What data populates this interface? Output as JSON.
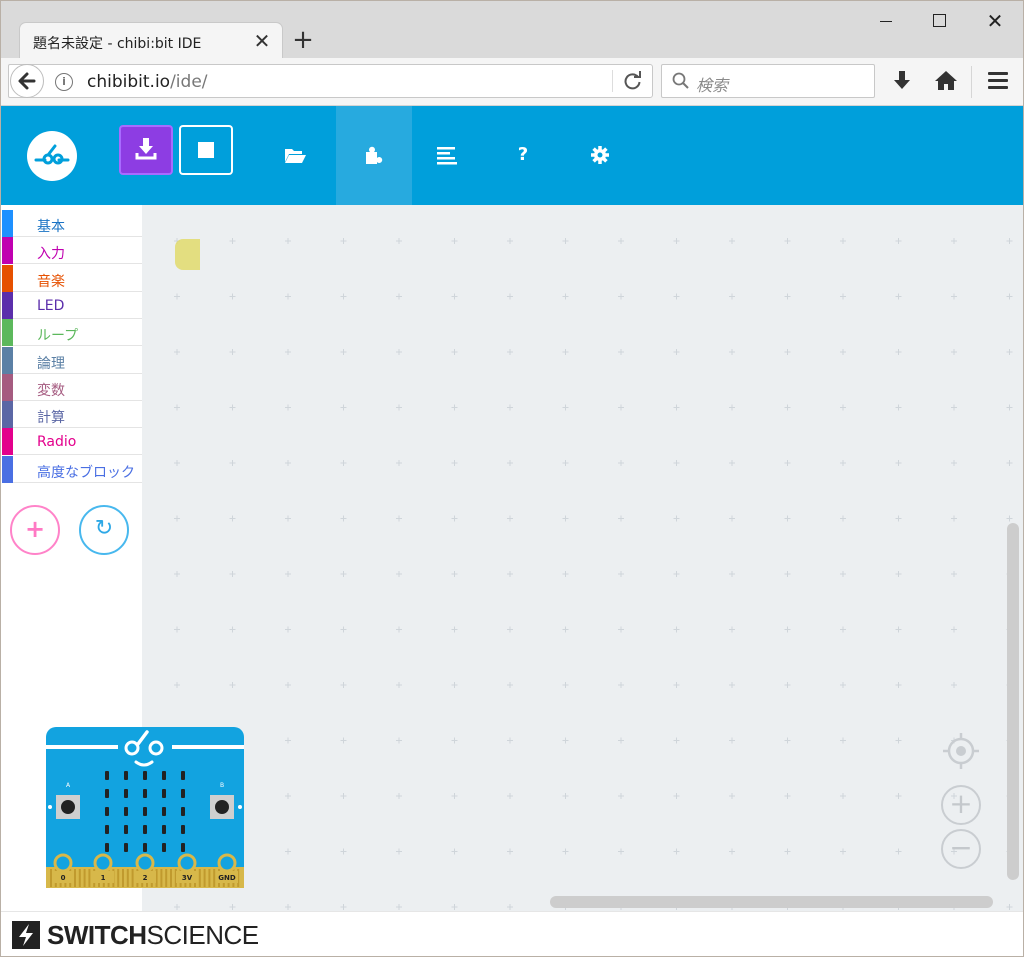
{
  "browser": {
    "tab_title": "題名未設定 - chibi:bit IDE",
    "tab_close": "✕",
    "new_tab": "+",
    "url_host": "chibibit.io",
    "url_path": "/ide/",
    "search_placeholder": "検索",
    "info": "i"
  },
  "header": {
    "buttons": [
      "flash",
      "stop",
      "open",
      "blocks",
      "code",
      "help",
      "settings"
    ],
    "active_tab": "blocks",
    "help_label": "?"
  },
  "categories": [
    {
      "label": "基本",
      "color": "#1e90ff",
      "text_color": "#1a73c4"
    },
    {
      "label": "入力",
      "color": "#c000b0",
      "text_color": "#c000b0"
    },
    {
      "label": "音楽",
      "color": "#e65000",
      "text_color": "#e65000"
    },
    {
      "label": "LED",
      "color": "#5b2eab",
      "text_color": "#5b2eab"
    },
    {
      "label": "ループ",
      "color": "#5cb85c",
      "text_color": "#5cb85c"
    },
    {
      "label": "論理",
      "color": "#5b80a5",
      "text_color": "#5b80a5"
    },
    {
      "label": "変数",
      "color": "#a55b80",
      "text_color": "#a55b80"
    },
    {
      "label": "計算",
      "color": "#5b67a5",
      "text_color": "#5b67a5"
    },
    {
      "label": "Radio",
      "color": "#e3008c",
      "text_color": "#e3008c"
    },
    {
      "label": "高度なブロック",
      "color": "#4a6fe3",
      "text_color": "#4a6fe3"
    }
  ],
  "sidebar_actions": {
    "add": "+",
    "reset": "↻"
  },
  "microbit": {
    "button_a": "A",
    "button_b": "B",
    "pins": [
      "0",
      "1",
      "2",
      "3V",
      "GND"
    ]
  },
  "zoom": {
    "in": "+",
    "out": "−"
  },
  "footer": {
    "brand_bold": "SWITCH",
    "brand_light": "SCIENCE"
  },
  "colors": {
    "header_bg": "#009fdb",
    "flash_bg": "#8d3de3",
    "workspace_bg": "#eceff1"
  }
}
